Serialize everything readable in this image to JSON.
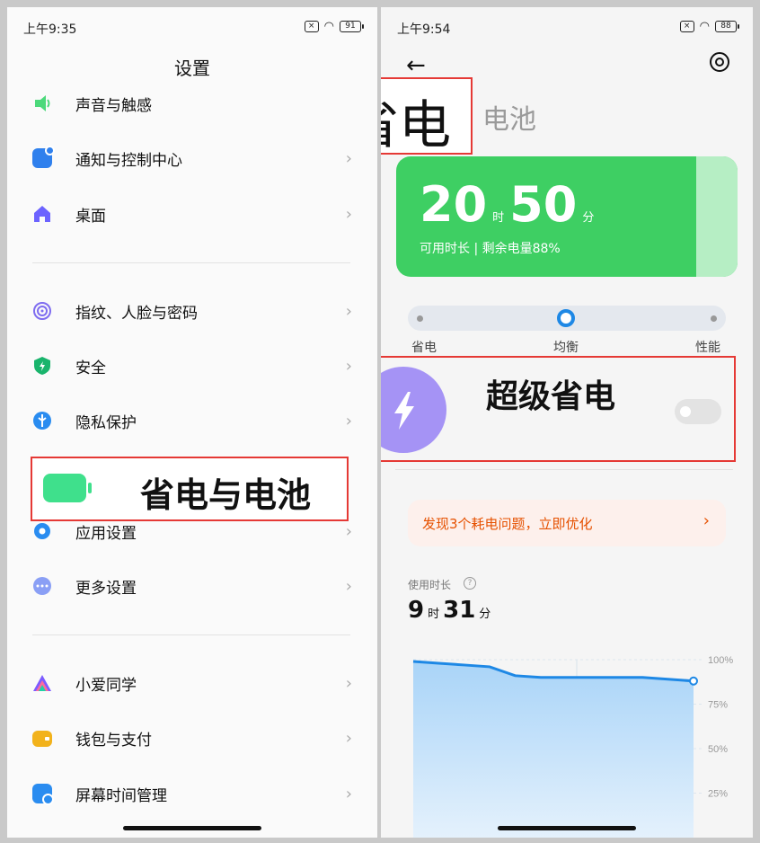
{
  "left": {
    "status": {
      "time": "上午9:35",
      "battery": "91"
    },
    "title": "设置",
    "items": [
      {
        "label": "声音与触感",
        "icon": "speaker-icon",
        "color": "#4cd97b"
      },
      {
        "label": "通知与控制中心",
        "icon": "notification-icon",
        "color": "#2f80ed"
      },
      {
        "label": "桌面",
        "icon": "home-icon",
        "color": "#6c63ff"
      },
      {
        "label": "指纹、人脸与密码",
        "icon": "fingerprint-icon",
        "color": "#7e6cf0"
      },
      {
        "label": "安全",
        "icon": "shield-icon",
        "color": "#19b46c"
      },
      {
        "label": "隐私保护",
        "icon": "privacy-icon",
        "color": "#2a8cf0"
      },
      {
        "label": "应用设置",
        "icon": "app-settings-icon",
        "color": "#2a8cf0"
      },
      {
        "label": "更多设置",
        "icon": "more-icon",
        "color": "#8a9ff5"
      },
      {
        "label": "小爱同学",
        "icon": "xiaoai-icon",
        "color": "#ff6b9d"
      },
      {
        "label": "钱包与支付",
        "icon": "wallet-icon",
        "color": "#f2b21b"
      },
      {
        "label": "屏幕时间管理",
        "icon": "screen-time-icon",
        "color": "#2a8cf0"
      }
    ],
    "callout_label": "省电与电池",
    "callout_icon_color": "#3fe08c"
  },
  "right": {
    "status": {
      "time": "上午9:54",
      "battery": "88"
    },
    "heading_callout": "省电",
    "subheading": "电池",
    "card": {
      "hours": "20",
      "hours_unit": "时",
      "minutes": "50",
      "minutes_unit": "分",
      "caption": "可用时长 | 剩余电量88%"
    },
    "modes": [
      "省电",
      "均衡",
      "性能"
    ],
    "super_saver_label": "超级省电",
    "tip": "发现3个耗电问题，立即优化",
    "usage": {
      "label": "使用时长",
      "hours": "9",
      "hours_unit": "时",
      "minutes": "31",
      "minutes_unit": "分"
    },
    "chart_data": {
      "type": "area",
      "y_ticks": [
        "100%",
        "75%",
        "50%",
        "25%"
      ],
      "ylim": [
        0,
        100
      ],
      "values": [
        99,
        98,
        97,
        96,
        91,
        90,
        90,
        90,
        90,
        90,
        89,
        88
      ],
      "color": "#1e88e5"
    }
  }
}
